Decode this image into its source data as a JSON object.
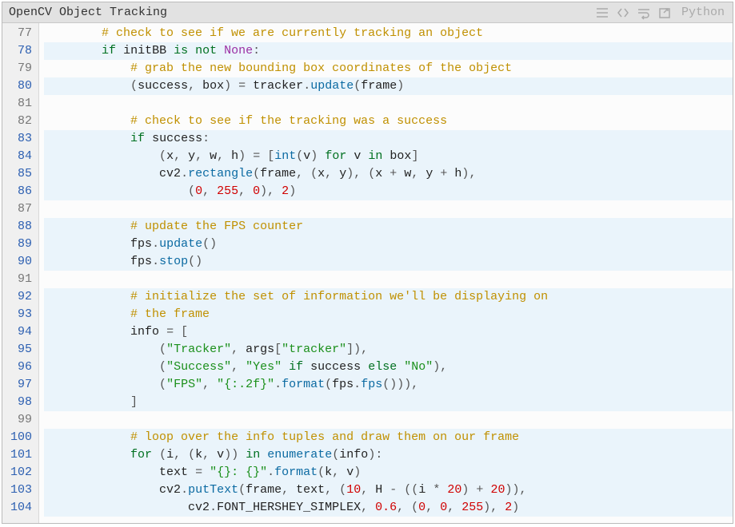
{
  "header": {
    "title": "OpenCV Object Tracking",
    "language": "Python"
  },
  "gutter_start": 77,
  "highlighted_lines": [
    78,
    80,
    83,
    84,
    85,
    86,
    88,
    89,
    90,
    92,
    93,
    94,
    95,
    96,
    97,
    98,
    100,
    101,
    102,
    103,
    104
  ],
  "lines": [
    [
      {
        "t": "        ",
        "c": "pl"
      },
      {
        "t": "# check to see if we are currently tracking an object",
        "c": "cmt"
      }
    ],
    [
      {
        "t": "        ",
        "c": "pl"
      },
      {
        "t": "if",
        "c": "kw"
      },
      {
        "t": " ",
        "c": "pl"
      },
      {
        "t": "initBB",
        "c": "nm"
      },
      {
        "t": " ",
        "c": "pl"
      },
      {
        "t": "is",
        "c": "kw"
      },
      {
        "t": " ",
        "c": "pl"
      },
      {
        "t": "not",
        "c": "kw"
      },
      {
        "t": " ",
        "c": "pl"
      },
      {
        "t": "None",
        "c": "kwn"
      },
      {
        "t": ":",
        "c": "op"
      }
    ],
    [
      {
        "t": "            ",
        "c": "pl"
      },
      {
        "t": "# grab the new bounding box coordinates of the object",
        "c": "cmt"
      }
    ],
    [
      {
        "t": "            ",
        "c": "pl"
      },
      {
        "t": "(",
        "c": "par"
      },
      {
        "t": "success",
        "c": "nm"
      },
      {
        "t": ", ",
        "c": "op"
      },
      {
        "t": "box",
        "c": "nm"
      },
      {
        "t": ")",
        "c": "par"
      },
      {
        "t": " ",
        "c": "pl"
      },
      {
        "t": "=",
        "c": "op"
      },
      {
        "t": " ",
        "c": "pl"
      },
      {
        "t": "tracker",
        "c": "nm"
      },
      {
        "t": ".",
        "c": "op"
      },
      {
        "t": "update",
        "c": "fn"
      },
      {
        "t": "(",
        "c": "par"
      },
      {
        "t": "frame",
        "c": "nm"
      },
      {
        "t": ")",
        "c": "par"
      }
    ],
    [],
    [
      {
        "t": "            ",
        "c": "pl"
      },
      {
        "t": "# check to see if the tracking was a success",
        "c": "cmt"
      }
    ],
    [
      {
        "t": "            ",
        "c": "pl"
      },
      {
        "t": "if",
        "c": "kw"
      },
      {
        "t": " ",
        "c": "pl"
      },
      {
        "t": "success",
        "c": "nm"
      },
      {
        "t": ":",
        "c": "op"
      }
    ],
    [
      {
        "t": "                ",
        "c": "pl"
      },
      {
        "t": "(",
        "c": "par"
      },
      {
        "t": "x",
        "c": "nm"
      },
      {
        "t": ", ",
        "c": "op"
      },
      {
        "t": "y",
        "c": "nm"
      },
      {
        "t": ", ",
        "c": "op"
      },
      {
        "t": "w",
        "c": "nm"
      },
      {
        "t": ", ",
        "c": "op"
      },
      {
        "t": "h",
        "c": "nm"
      },
      {
        "t": ")",
        "c": "par"
      },
      {
        "t": " ",
        "c": "pl"
      },
      {
        "t": "=",
        "c": "op"
      },
      {
        "t": " ",
        "c": "pl"
      },
      {
        "t": "[",
        "c": "par"
      },
      {
        "t": "int",
        "c": "fn"
      },
      {
        "t": "(",
        "c": "par"
      },
      {
        "t": "v",
        "c": "nm"
      },
      {
        "t": ")",
        "c": "par"
      },
      {
        "t": " ",
        "c": "pl"
      },
      {
        "t": "for",
        "c": "kw"
      },
      {
        "t": " ",
        "c": "pl"
      },
      {
        "t": "v",
        "c": "nm"
      },
      {
        "t": " ",
        "c": "pl"
      },
      {
        "t": "in",
        "c": "kw"
      },
      {
        "t": " ",
        "c": "pl"
      },
      {
        "t": "box",
        "c": "nm"
      },
      {
        "t": "]",
        "c": "par"
      }
    ],
    [
      {
        "t": "                ",
        "c": "pl"
      },
      {
        "t": "cv2",
        "c": "nm"
      },
      {
        "t": ".",
        "c": "op"
      },
      {
        "t": "rectangle",
        "c": "fn"
      },
      {
        "t": "(",
        "c": "par"
      },
      {
        "t": "frame",
        "c": "nm"
      },
      {
        "t": ", ",
        "c": "op"
      },
      {
        "t": "(",
        "c": "par"
      },
      {
        "t": "x",
        "c": "nm"
      },
      {
        "t": ", ",
        "c": "op"
      },
      {
        "t": "y",
        "c": "nm"
      },
      {
        "t": ")",
        "c": "par"
      },
      {
        "t": ", ",
        "c": "op"
      },
      {
        "t": "(",
        "c": "par"
      },
      {
        "t": "x",
        "c": "nm"
      },
      {
        "t": " ",
        "c": "pl"
      },
      {
        "t": "+",
        "c": "op"
      },
      {
        "t": " ",
        "c": "pl"
      },
      {
        "t": "w",
        "c": "nm"
      },
      {
        "t": ", ",
        "c": "op"
      },
      {
        "t": "y",
        "c": "nm"
      },
      {
        "t": " ",
        "c": "pl"
      },
      {
        "t": "+",
        "c": "op"
      },
      {
        "t": " ",
        "c": "pl"
      },
      {
        "t": "h",
        "c": "nm"
      },
      {
        "t": ")",
        "c": "par"
      },
      {
        "t": ",",
        "c": "op"
      }
    ],
    [
      {
        "t": "                    ",
        "c": "pl"
      },
      {
        "t": "(",
        "c": "par"
      },
      {
        "t": "0",
        "c": "num"
      },
      {
        "t": ", ",
        "c": "op"
      },
      {
        "t": "255",
        "c": "num"
      },
      {
        "t": ", ",
        "c": "op"
      },
      {
        "t": "0",
        "c": "num"
      },
      {
        "t": ")",
        "c": "par"
      },
      {
        "t": ", ",
        "c": "op"
      },
      {
        "t": "2",
        "c": "num"
      },
      {
        "t": ")",
        "c": "par"
      }
    ],
    [],
    [
      {
        "t": "            ",
        "c": "pl"
      },
      {
        "t": "# update the FPS counter",
        "c": "cmt"
      }
    ],
    [
      {
        "t": "            ",
        "c": "pl"
      },
      {
        "t": "fps",
        "c": "nm"
      },
      {
        "t": ".",
        "c": "op"
      },
      {
        "t": "update",
        "c": "fn"
      },
      {
        "t": "(",
        "c": "par"
      },
      {
        "t": ")",
        "c": "par"
      }
    ],
    [
      {
        "t": "            ",
        "c": "pl"
      },
      {
        "t": "fps",
        "c": "nm"
      },
      {
        "t": ".",
        "c": "op"
      },
      {
        "t": "stop",
        "c": "fn"
      },
      {
        "t": "(",
        "c": "par"
      },
      {
        "t": ")",
        "c": "par"
      }
    ],
    [],
    [
      {
        "t": "            ",
        "c": "pl"
      },
      {
        "t": "# initialize the set of information we'll be displaying on",
        "c": "cmt"
      }
    ],
    [
      {
        "t": "            ",
        "c": "pl"
      },
      {
        "t": "# the frame",
        "c": "cmt"
      }
    ],
    [
      {
        "t": "            ",
        "c": "pl"
      },
      {
        "t": "info",
        "c": "nm"
      },
      {
        "t": " ",
        "c": "pl"
      },
      {
        "t": "=",
        "c": "op"
      },
      {
        "t": " ",
        "c": "pl"
      },
      {
        "t": "[",
        "c": "par"
      }
    ],
    [
      {
        "t": "                ",
        "c": "pl"
      },
      {
        "t": "(",
        "c": "par"
      },
      {
        "t": "\"Tracker\"",
        "c": "str"
      },
      {
        "t": ", ",
        "c": "op"
      },
      {
        "t": "args",
        "c": "nm"
      },
      {
        "t": "[",
        "c": "par"
      },
      {
        "t": "\"tracker\"",
        "c": "str"
      },
      {
        "t": "]",
        "c": "par"
      },
      {
        "t": ")",
        "c": "par"
      },
      {
        "t": ",",
        "c": "op"
      }
    ],
    [
      {
        "t": "                ",
        "c": "pl"
      },
      {
        "t": "(",
        "c": "par"
      },
      {
        "t": "\"Success\"",
        "c": "str"
      },
      {
        "t": ", ",
        "c": "op"
      },
      {
        "t": "\"Yes\"",
        "c": "str"
      },
      {
        "t": " ",
        "c": "pl"
      },
      {
        "t": "if",
        "c": "kw"
      },
      {
        "t": " ",
        "c": "pl"
      },
      {
        "t": "success",
        "c": "nm"
      },
      {
        "t": " ",
        "c": "pl"
      },
      {
        "t": "else",
        "c": "kw"
      },
      {
        "t": " ",
        "c": "pl"
      },
      {
        "t": "\"No\"",
        "c": "str"
      },
      {
        "t": ")",
        "c": "par"
      },
      {
        "t": ",",
        "c": "op"
      }
    ],
    [
      {
        "t": "                ",
        "c": "pl"
      },
      {
        "t": "(",
        "c": "par"
      },
      {
        "t": "\"FPS\"",
        "c": "str"
      },
      {
        "t": ", ",
        "c": "op"
      },
      {
        "t": "\"{:.2f}\"",
        "c": "str"
      },
      {
        "t": ".",
        "c": "op"
      },
      {
        "t": "format",
        "c": "fn"
      },
      {
        "t": "(",
        "c": "par"
      },
      {
        "t": "fps",
        "c": "nm"
      },
      {
        "t": ".",
        "c": "op"
      },
      {
        "t": "fps",
        "c": "fn"
      },
      {
        "t": "(",
        "c": "par"
      },
      {
        "t": ")",
        "c": "par"
      },
      {
        "t": ")",
        "c": "par"
      },
      {
        "t": ")",
        "c": "par"
      },
      {
        "t": ",",
        "c": "op"
      }
    ],
    [
      {
        "t": "            ",
        "c": "pl"
      },
      {
        "t": "]",
        "c": "par"
      }
    ],
    [],
    [
      {
        "t": "            ",
        "c": "pl"
      },
      {
        "t": "# loop over the info tuples and draw them on our frame",
        "c": "cmt"
      }
    ],
    [
      {
        "t": "            ",
        "c": "pl"
      },
      {
        "t": "for",
        "c": "kw"
      },
      {
        "t": " ",
        "c": "pl"
      },
      {
        "t": "(",
        "c": "par"
      },
      {
        "t": "i",
        "c": "nm"
      },
      {
        "t": ", ",
        "c": "op"
      },
      {
        "t": "(",
        "c": "par"
      },
      {
        "t": "k",
        "c": "nm"
      },
      {
        "t": ", ",
        "c": "op"
      },
      {
        "t": "v",
        "c": "nm"
      },
      {
        "t": ")",
        "c": "par"
      },
      {
        "t": ")",
        "c": "par"
      },
      {
        "t": " ",
        "c": "pl"
      },
      {
        "t": "in",
        "c": "kw"
      },
      {
        "t": " ",
        "c": "pl"
      },
      {
        "t": "enumerate",
        "c": "fn"
      },
      {
        "t": "(",
        "c": "par"
      },
      {
        "t": "info",
        "c": "nm"
      },
      {
        "t": ")",
        "c": "par"
      },
      {
        "t": ":",
        "c": "op"
      }
    ],
    [
      {
        "t": "                ",
        "c": "pl"
      },
      {
        "t": "text",
        "c": "nm"
      },
      {
        "t": " ",
        "c": "pl"
      },
      {
        "t": "=",
        "c": "op"
      },
      {
        "t": " ",
        "c": "pl"
      },
      {
        "t": "\"{}: {}\"",
        "c": "str"
      },
      {
        "t": ".",
        "c": "op"
      },
      {
        "t": "format",
        "c": "fn"
      },
      {
        "t": "(",
        "c": "par"
      },
      {
        "t": "k",
        "c": "nm"
      },
      {
        "t": ", ",
        "c": "op"
      },
      {
        "t": "v",
        "c": "nm"
      },
      {
        "t": ")",
        "c": "par"
      }
    ],
    [
      {
        "t": "                ",
        "c": "pl"
      },
      {
        "t": "cv2",
        "c": "nm"
      },
      {
        "t": ".",
        "c": "op"
      },
      {
        "t": "putText",
        "c": "fn"
      },
      {
        "t": "(",
        "c": "par"
      },
      {
        "t": "frame",
        "c": "nm"
      },
      {
        "t": ", ",
        "c": "op"
      },
      {
        "t": "text",
        "c": "nm"
      },
      {
        "t": ", ",
        "c": "op"
      },
      {
        "t": "(",
        "c": "par"
      },
      {
        "t": "10",
        "c": "num"
      },
      {
        "t": ", ",
        "c": "op"
      },
      {
        "t": "H",
        "c": "nm"
      },
      {
        "t": " ",
        "c": "pl"
      },
      {
        "t": "-",
        "c": "op"
      },
      {
        "t": " ",
        "c": "pl"
      },
      {
        "t": "(",
        "c": "par"
      },
      {
        "t": "(",
        "c": "par"
      },
      {
        "t": "i",
        "c": "nm"
      },
      {
        "t": " ",
        "c": "pl"
      },
      {
        "t": "*",
        "c": "op"
      },
      {
        "t": " ",
        "c": "pl"
      },
      {
        "t": "20",
        "c": "num"
      },
      {
        "t": ")",
        "c": "par"
      },
      {
        "t": " ",
        "c": "pl"
      },
      {
        "t": "+",
        "c": "op"
      },
      {
        "t": " ",
        "c": "pl"
      },
      {
        "t": "20",
        "c": "num"
      },
      {
        "t": ")",
        "c": "par"
      },
      {
        "t": ")",
        "c": "par"
      },
      {
        "t": ",",
        "c": "op"
      }
    ],
    [
      {
        "t": "                    ",
        "c": "pl"
      },
      {
        "t": "cv2",
        "c": "nm"
      },
      {
        "t": ".",
        "c": "op"
      },
      {
        "t": "FONT_HERSHEY_SIMPLEX",
        "c": "nm"
      },
      {
        "t": ", ",
        "c": "op"
      },
      {
        "t": "0.6",
        "c": "num"
      },
      {
        "t": ", ",
        "c": "op"
      },
      {
        "t": "(",
        "c": "par"
      },
      {
        "t": "0",
        "c": "num"
      },
      {
        "t": ", ",
        "c": "op"
      },
      {
        "t": "0",
        "c": "num"
      },
      {
        "t": ", ",
        "c": "op"
      },
      {
        "t": "255",
        "c": "num"
      },
      {
        "t": ")",
        "c": "par"
      },
      {
        "t": ", ",
        "c": "op"
      },
      {
        "t": "2",
        "c": "num"
      },
      {
        "t": ")",
        "c": "par"
      }
    ]
  ]
}
